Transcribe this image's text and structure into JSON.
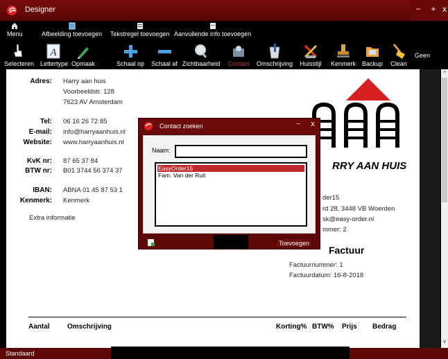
{
  "window": {
    "title": "Designer",
    "min_label": "−",
    "max_label": "+",
    "close_label": "x"
  },
  "menubar": {
    "items": [
      {
        "label": "Menu",
        "icon": "home-icon"
      },
      {
        "label": "Afbeelding toevoegen",
        "icon": "image-icon"
      },
      {
        "label": "Tekstregel toevoegen",
        "icon": "text-line-icon"
      },
      {
        "label": "Aanvullende info toevoegen",
        "icon": "document-icon"
      }
    ]
  },
  "toolbar": {
    "items": [
      {
        "label": "Selecteren",
        "icon": "hand-pointer-icon"
      },
      {
        "label": "Lettertype",
        "icon": "font-icon"
      },
      {
        "label": "Opmaak",
        "icon": "pen-icon"
      },
      {
        "label": "Schaal op",
        "icon": "plus-icon"
      },
      {
        "label": "Schaal af",
        "icon": "minus-icon"
      },
      {
        "label": "Zichtbaarheid",
        "icon": "magnifier-icon"
      },
      {
        "label": "Contact",
        "icon": "contact-icon"
      },
      {
        "label": "Omschrijving",
        "icon": "cup-icon"
      },
      {
        "label": "Huisstijl",
        "icon": "palette-icon"
      },
      {
        "label": "Kenmerk",
        "icon": "stamp-icon"
      },
      {
        "label": "Backup",
        "icon": "folder-icon"
      },
      {
        "label": "Clean",
        "icon": "broom-icon"
      }
    ],
    "extra_label": "Geen"
  },
  "document": {
    "address": {
      "adres_label": "Adres:",
      "lines": [
        "Harry aan huis",
        "Voorbeeldstr. 128",
        "7623 AV Amsterdam"
      ]
    },
    "contact": {
      "tel_label": "Tel:",
      "tel": "06 16 26 72 85",
      "email_label": "E-mail:",
      "email": "info@harryaanhuis.nl",
      "website_label": "Website:",
      "website": "www.harryaanhuis.nl"
    },
    "registration": {
      "kvk_label": "KvK nr:",
      "kvk": "87 65 37 84",
      "btw_label": "BTW nr:",
      "btw": "B01 3744 56 374 37"
    },
    "bank": {
      "iban_label": "IBAN:",
      "iban": "ABNA 01 45 87 53 1",
      "kenmerk_label": "Kenmerk:",
      "kenmerk": "Kenmerk"
    },
    "extra_info": "Extra informatie",
    "logo_text": "RRY AAN HUIS",
    "recipient": {
      "line1": "der15",
      "line2": "rd 28, 3448 VB Woerden",
      "line3": "sk@easy-order.nl",
      "line4": "mmer: 2"
    },
    "invoice": {
      "heading": "Factuur",
      "number": "Factuurnummer: 1",
      "date": "Factuurdatum: 16-8-2018"
    },
    "table_headers": {
      "aantal": "Aantal",
      "omschrijving": "Omschrijving",
      "korting": "Korting%",
      "btw": "BTW%",
      "prijs": "Prijs",
      "bedrag": "Bedrag"
    }
  },
  "dialog": {
    "title": "Contact zoeken",
    "min_label": "−",
    "close_label": "x",
    "naam_label": "Naam:",
    "naam_value": "",
    "contacts": [
      "EasyOrder15",
      "Fam. Van der Ruit"
    ],
    "selected_index": 0,
    "submit_label": "Toevoegen"
  },
  "status": {
    "text": "Standaard"
  },
  "colors": {
    "brand_dark_red": "#5e0808",
    "accent_red": "#d61f1f",
    "selection": "#c0292b"
  }
}
